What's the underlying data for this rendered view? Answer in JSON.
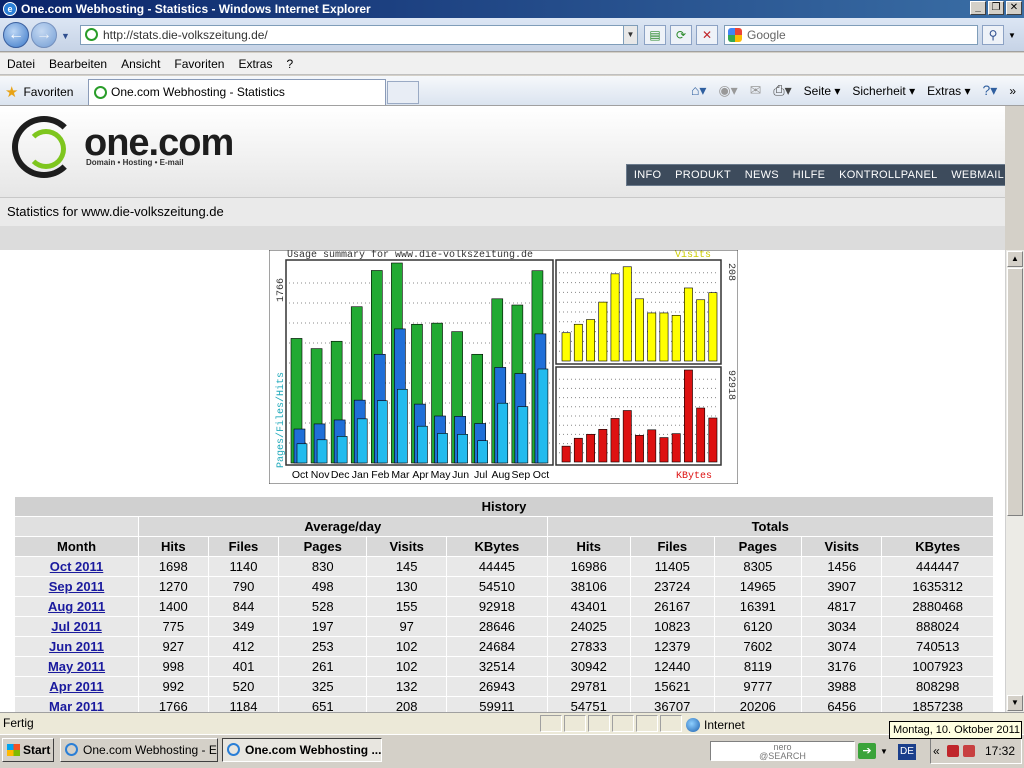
{
  "window": {
    "title": "One.com Webhosting - Statistics - Windows Internet Explorer"
  },
  "address": {
    "url": "http://stats.die-volkszeitung.de/",
    "search_placeholder": "Google"
  },
  "menu": [
    "Datei",
    "Bearbeiten",
    "Ansicht",
    "Favoriten",
    "Extras",
    "?"
  ],
  "favbar": {
    "favorites_label": "Favoriten",
    "tab_title": "One.com Webhosting - Statistics",
    "commands": {
      "seite": "Seite",
      "sicherheit": "Sicherheit",
      "extras": "Extras"
    }
  },
  "site": {
    "logo": "one.com",
    "tagline": "Domain • Hosting • E-mail",
    "nav": [
      "INFO",
      "PRODUKT",
      "NEWS",
      "HILFE",
      "KONTROLLPANEL",
      "WEBMAIL"
    ],
    "stats_title": "Statistics for www.die-volkszeitung.de"
  },
  "chart_data": {
    "type": "bar",
    "title": "Usage summary for www.die-volkszeitung.de",
    "categories": [
      "Oct",
      "Nov",
      "Dec",
      "Jan",
      "Feb",
      "Mar",
      "Apr",
      "May",
      "Jun",
      "Jul",
      "Aug",
      "Sep",
      "Oct"
    ],
    "ylabel": "Pages/Files/Hits",
    "max_left_label": "1766",
    "visits_label": "Visits",
    "visits_max_label": "208",
    "kbytes_label": "KBytes",
    "kbytes_max_label": "92918",
    "max_hits": 1766,
    "max_visits": 208,
    "max_kbytes": 92918,
    "series": [
      {
        "name": "Hits",
        "color": "#22aa33",
        "values": [
          1100,
          1010,
          1075,
          1380,
          1700,
          1766,
          1225,
          1235,
          1160,
          960,
          1450,
          1395,
          1698
        ]
      },
      {
        "name": "Files",
        "color": "#1f6fd8",
        "values": [
          300,
          345,
          380,
          555,
          960,
          1184,
          520,
          415,
          412,
          349,
          844,
          790,
          1140
        ]
      },
      {
        "name": "Pages",
        "color": "#22bbee",
        "values": [
          170,
          205,
          235,
          390,
          550,
          651,
          325,
          261,
          253,
          197,
          528,
          498,
          830
        ]
      },
      {
        "name": "Visits",
        "color": "#ffff00",
        "values": [
          60,
          78,
          88,
          125,
          185,
          200,
          132,
          102,
          102,
          97,
          155,
          130,
          145
        ]
      },
      {
        "name": "KBytes",
        "color": "#dd1111",
        "values": [
          16000,
          24000,
          28000,
          33000,
          44000,
          52000,
          26943,
          32514,
          24684,
          28646,
          92918,
          54510,
          44445
        ]
      }
    ]
  },
  "history": {
    "caption": "History",
    "group_avg": "Average/day",
    "group_tot": "Totals",
    "columns": [
      "Month",
      "Hits",
      "Files",
      "Pages",
      "Visits",
      "KBytes",
      "Hits",
      "Files",
      "Pages",
      "Visits",
      "KBytes"
    ],
    "rows": [
      [
        "Oct 2011",
        "1698",
        "1140",
        "830",
        "145",
        "44445",
        "16986",
        "11405",
        "8305",
        "1456",
        "444447"
      ],
      [
        "Sep 2011",
        "1270",
        "790",
        "498",
        "130",
        "54510",
        "38106",
        "23724",
        "14965",
        "3907",
        "1635312"
      ],
      [
        "Aug 2011",
        "1400",
        "844",
        "528",
        "155",
        "92918",
        "43401",
        "26167",
        "16391",
        "4817",
        "2880468"
      ],
      [
        "Jul 2011",
        "775",
        "349",
        "197",
        "97",
        "28646",
        "24025",
        "10823",
        "6120",
        "3034",
        "888024"
      ],
      [
        "Jun 2011",
        "927",
        "412",
        "253",
        "102",
        "24684",
        "27833",
        "12379",
        "7602",
        "3074",
        "740513"
      ],
      [
        "May 2011",
        "998",
        "401",
        "261",
        "102",
        "32514",
        "30942",
        "12440",
        "8119",
        "3176",
        "1007923"
      ],
      [
        "Apr 2011",
        "992",
        "520",
        "325",
        "132",
        "26943",
        "29781",
        "15621",
        "9777",
        "3988",
        "808298"
      ],
      [
        "Mar 2011",
        "1766",
        "1184",
        "651",
        "208",
        "59911",
        "54751",
        "36707",
        "20206",
        "6456",
        "1857238"
      ]
    ]
  },
  "status": {
    "text": "Fertig",
    "zone": "Internet",
    "tooltip": "Montag, 10. Oktober 2011"
  },
  "taskbar": {
    "start": "Start",
    "tasks": [
      "One.com Webhosting - E...",
      "One.com Webhosting ..."
    ],
    "nero_line1": "nero",
    "nero_line2": "@SEARCH",
    "lang": "DE",
    "clock": "17:32"
  }
}
